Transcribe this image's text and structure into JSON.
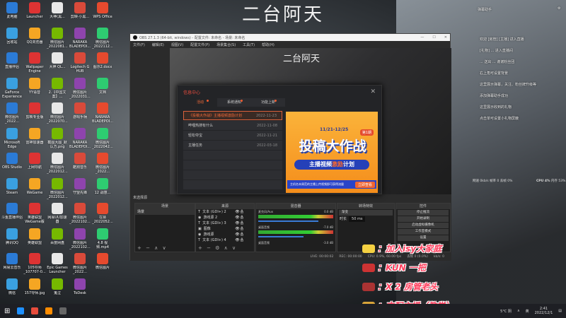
{
  "wallpaper": {
    "title": "二台阿天",
    "title2": "今日"
  },
  "desktop_icons": [
    [
      "此电脑",
      "Launcher",
      "大神(黑...",
      "剪映·小黑...",
      "WPS Office"
    ],
    [
      "回收站",
      "QQ浏览器",
      "微信图片_2022081...",
      "NARAKA BLADEPOI...",
      "微信图片_2022112..."
    ],
    [
      "直播伴侣",
      "Wallpaper Engine",
      "大神 QL...",
      "Logitech G HUB",
      "图示2.docx"
    ],
    [
      "GeForce Experience",
      "YY语音",
      "2.【中国文案】...",
      "微信图片_2022031...",
      "文档"
    ],
    [
      "微信图片_2022...",
      "剪映专业版",
      "微信图片_2022070...",
      "游戏手柄",
      "NARAKA BLADEPOI..."
    ],
    [
      "Microsoft Edge",
      "雷神加速器",
      "截图大图_默认方.png",
      "NARAKA BLADEPOI...",
      "微信图片_2022042..."
    ],
    [
      "OBS Studio",
      "上网导航",
      "微信图片_2022012...",
      "酷狗音乐",
      "微信图片_2022..."
    ],
    [
      "Steam",
      "WeGame",
      "微信图片_2022012...",
      "守望先锋",
      "12 战意..."
    ],
    [
      "斗鱼直播伴侣",
      "英雄联盟WeGame版",
      "网易UU加速器",
      "微信图片_2022102...",
      "在猜_2022052..."
    ],
    [
      "腾讯QQ",
      "英雄联盟",
      "百度网盘",
      "微信图片_2022102...",
      "4.8 视频.mp4"
    ],
    [
      "网易云音乐",
      "105导师_107707-0...",
      "Epic Games Launcher",
      "微信图片_2022...",
      "微信图片"
    ],
    [
      "微信",
      "157导师.jpg",
      "鬼泣",
      "ToDesk",
      ""
    ]
  ],
  "icon_colors": [
    "#2b7bd6",
    "#d33",
    "#e8e8e8",
    "#d94a3a",
    "#e64a2e",
    "#3aa0e0",
    "#f5a623",
    "#76b900",
    "#8e44ad",
    "#2ecc71"
  ],
  "obs": {
    "title": "OBS 27.1.3 (64-bit, windows) - 配置文件: 未命名 - 场景: 未命名",
    "window_controls": [
      "—",
      "☐",
      "✕"
    ],
    "menu": [
      "文件(F)",
      "编辑(E)",
      "视图(V)",
      "配置文件(P)",
      "场景集合(S)",
      "工具(T)",
      "帮助(H)"
    ],
    "preview_title": "二台阿天",
    "no_source": "未选择源",
    "docks": {
      "scenes": {
        "title": "场景",
        "items": [
          "场景"
        ]
      },
      "sources": {
        "title": "来源",
        "items": [
          {
            "icon": "T",
            "label": "文本 (GDI+) 2"
          },
          {
            "icon": "◉",
            "label": "游戏源 2"
          },
          {
            "icon": "T",
            "label": "文本 (GDI+) 3"
          },
          {
            "icon": "▣",
            "label": "图像"
          },
          {
            "icon": "◉",
            "label": "游戏源"
          },
          {
            "icon": "T",
            "label": "文本 (GDI+) 4"
          }
        ]
      },
      "mixer": {
        "title": "混音器",
        "channels": [
          {
            "name": "麦克风/Aux",
            "db": "0.0 dB"
          },
          {
            "name": "桌面音频",
            "db": "-7.0 dB"
          },
          {
            "name": "桌面音频",
            "db": "-3.0 dB"
          }
        ]
      },
      "transitions": {
        "title": "转场特效",
        "type": "渐变",
        "duration_label": "时长",
        "duration": "50 ms"
      },
      "controls": {
        "title": "控件",
        "buttons": [
          "停止推流",
          "开始录制",
          "启动虚拟摄像机",
          "工作室模式",
          "设置"
        ]
      }
    },
    "status": {
      "live": "LIVE: 00:00:02",
      "rec": "REC: 00:00:00",
      "cpu": "CPU: 0.9%, 60.00 fps",
      "dropped": "丢帧 0 (0.0%)",
      "kbps": "kb/s: 0"
    }
  },
  "dialog": {
    "title": "信息中心",
    "close": "✕",
    "tabs": [
      {
        "label": "活动",
        "badge": true
      },
      {
        "label": "系统通知",
        "badge": true
      },
      {
        "label": "功能上新",
        "badge": true
      }
    ],
    "news": [
      {
        "title": "《投稿大作战》主播视频激励计划",
        "date": "2022-11-23"
      },
      {
        "title": "哔哩热搜有什么",
        "date": "2022-11-08"
      },
      {
        "title": "轻松夺宝",
        "date": "2022-11-21"
      },
      {
        "title": "主播任务",
        "date": "2022-03-18"
      }
    ],
    "banner": {
      "dates": "11/21-12/25",
      "episode": "第1期",
      "headline": "投稿大作战",
      "sub_a": "主播视频",
      "sub_b": "激励",
      "sub_c": "计划",
      "footer": "主机名本周范的主播上传视频即可获得流量",
      "cta": "立即查看"
    }
  },
  "chat": {
    "title": "弹幕助手",
    "lines": [
      "欢迎 [房管] [主播] 进入直播",
      "[礼物] ... 进入直播间",
      "... 送出 ... 谢谢粉丝团",
      "右上角可设置背景",
      "这里展示弹幕，关注、粉丝牌升级等",
      "添加弹幕助手成功",
      "这里展示收到的礼物",
      "点击单可设置小礼物屏蔽"
    ]
  },
  "perf": {
    "net": "网速 0kb/s 帧率 0 丢帧 0%",
    "cpu": "CPU 4%",
    "mem": "内存 53%"
  },
  "danmu": [
    {
      "text": "：加入isy大家庭",
      "color": "#f5d142"
    },
    {
      "text": "：KUN 一把",
      "color": "#c33"
    },
    {
      "text": "：X 2 房管老头",
      "color": "#a33"
    },
    {
      "text": "：支配主播（教学）",
      "color": "#d9a43a"
    }
  ],
  "taskbar": {
    "weather": "5°C 阴",
    "ime": "英",
    "time": "2:41",
    "date": "2022/12/1",
    "apps_colors": [
      "#1e90ff",
      "#e74c3c",
      "#ff8c00",
      "#666"
    ]
  }
}
